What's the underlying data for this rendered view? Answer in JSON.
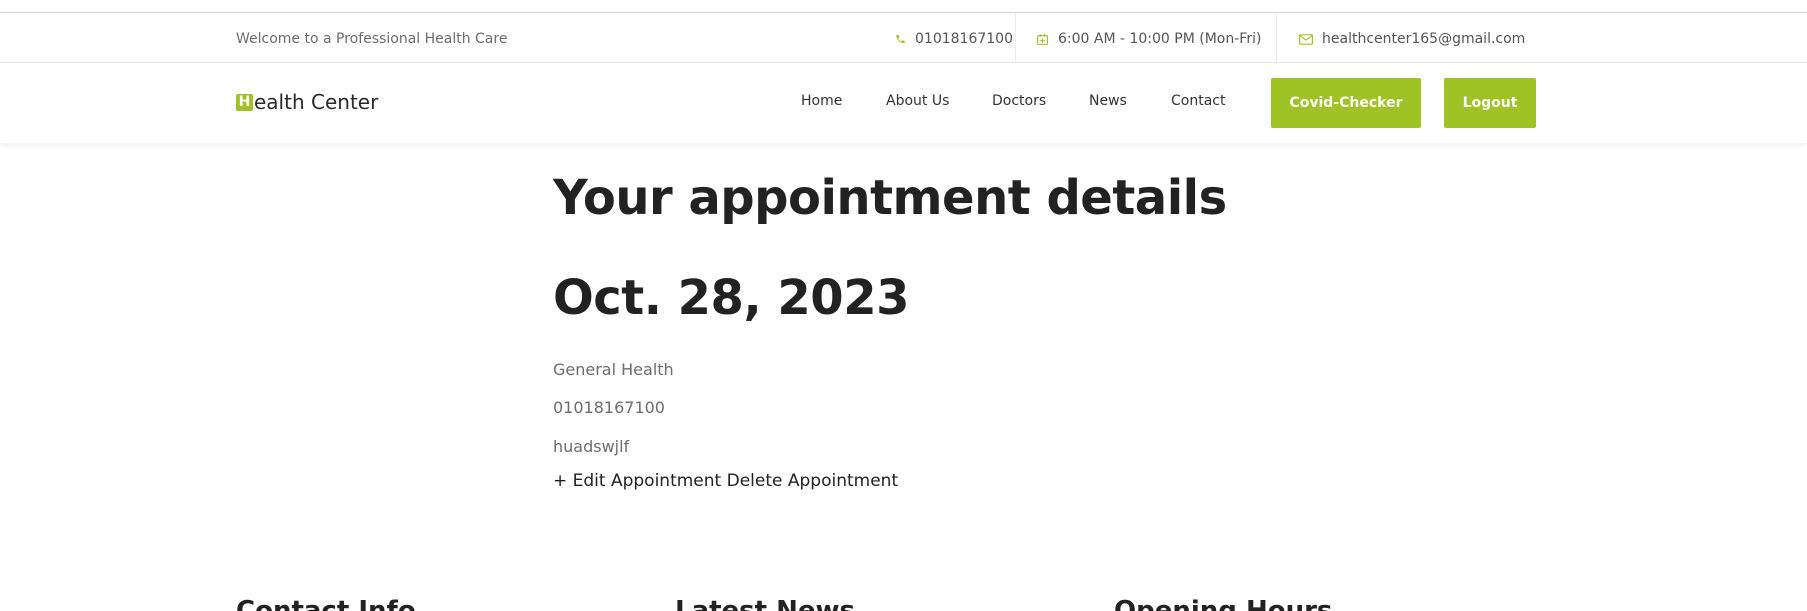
{
  "topbar": {
    "welcome": "Welcome to a Professional Health Care",
    "phone": "01018167100",
    "hours": "6:00 AM - 10:00 PM (Mon-Fri)",
    "email": "healthcenter165@gmail.com",
    "icons": [
      "phone-icon",
      "calendar-icon",
      "mail-icon"
    ]
  },
  "brand": {
    "initial": "H",
    "rest": "ealth Center",
    "accent_color": "#9fc225"
  },
  "nav": {
    "links": [
      "Home",
      "About Us",
      "Doctors",
      "News",
      "Contact"
    ],
    "covid_button": "Covid-Checker",
    "logout_button": "Logout"
  },
  "appointment": {
    "heading": "Your appointment details",
    "date": "Oct. 28, 2023",
    "department": "General Health",
    "phone": "01018167100",
    "message": "huadswjlf",
    "edit_label": "+ Edit Appointment",
    "delete_label": "Delete Appointment"
  },
  "footer": {
    "headings": [
      "Contact Info",
      "Latest News",
      "Opening Hours"
    ]
  }
}
